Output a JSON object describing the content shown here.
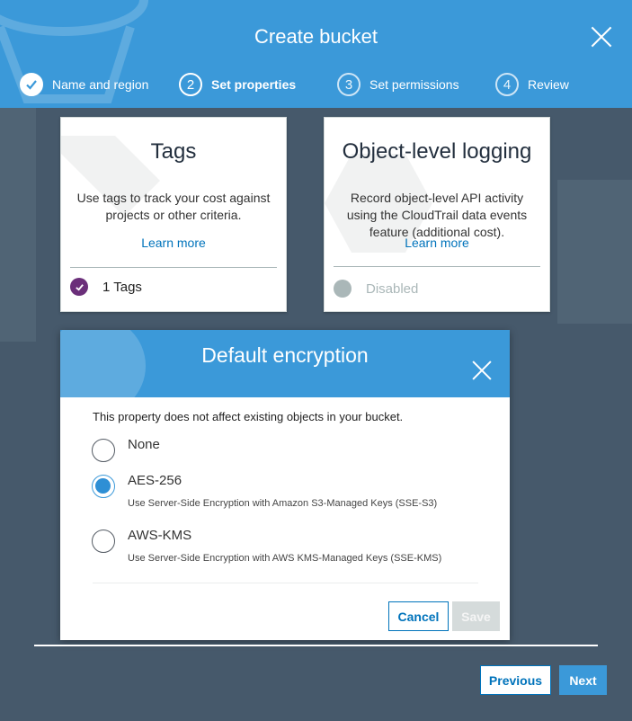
{
  "header": {
    "title": "Create bucket",
    "steps": [
      {
        "number": "1",
        "label": "Name and region",
        "state": "done"
      },
      {
        "number": "2",
        "label": "Set properties",
        "state": "active"
      },
      {
        "number": "3",
        "label": "Set permissions",
        "state": "future"
      },
      {
        "number": "4",
        "label": "Review",
        "state": "future"
      }
    ]
  },
  "cards": {
    "tags": {
      "title": "Tags",
      "description": "Use tags to track your cost against projects or other criteria.",
      "link": "Learn more",
      "status": "1 Tags"
    },
    "logging": {
      "title": "Object-level logging",
      "description": "Record object-level API activity using the CloudTrail data events feature (additional cost).",
      "link": "Learn more",
      "status": "Disabled"
    }
  },
  "encryption": {
    "title": "Default encryption",
    "note": "This property does not affect existing objects in your bucket.",
    "options": [
      {
        "name": "None",
        "description": "",
        "selected": false
      },
      {
        "name": "AES-256",
        "description": "Use Server-Side Encryption with Amazon S3-Managed Keys (SSE-S3)",
        "selected": true
      },
      {
        "name": "AWS-KMS",
        "description": "Use Server-Side Encryption with AWS KMS-Managed Keys (SSE-KMS)",
        "selected": false
      }
    ],
    "cancel_label": "Cancel",
    "save_label": "Save"
  },
  "footer": {
    "previous_label": "Previous",
    "next_label": "Next"
  },
  "colors": {
    "accent": "#3b99d9",
    "link": "#0073bb",
    "tag_check": "#6b2f7a",
    "disabled": "#aab7b8",
    "background": "#46596b"
  }
}
